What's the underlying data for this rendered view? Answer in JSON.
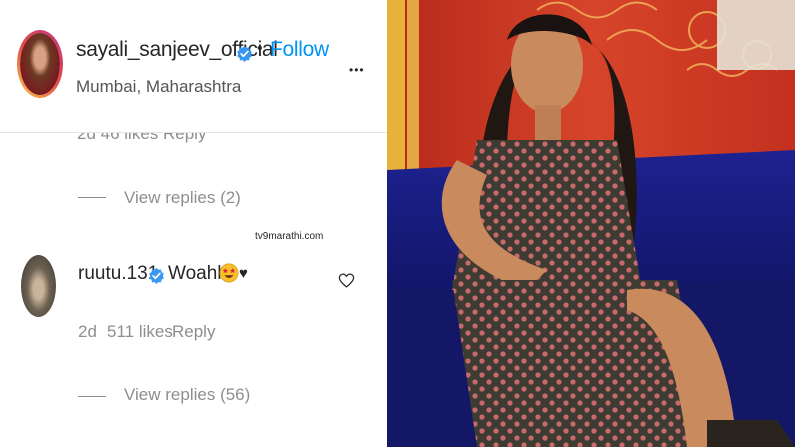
{
  "post_header": {
    "username": "sayali_sanjeev_official",
    "separator": "•",
    "follow_label": "Follow",
    "location": "Mumbai, Maharashtra",
    "more_label": "•••"
  },
  "previous_comment": {
    "meta": "2d   46 likes   Reply",
    "view_replies": "View replies (2)"
  },
  "watermark": "tv9marathi.com",
  "comment": {
    "username": "ruutu.131",
    "text": "Woahh",
    "emoji": "star-struck-emoji",
    "trailing": "♥",
    "time": "2d",
    "likes": "511 likes",
    "reply_label": "Reply",
    "view_replies": "View replies (56)"
  },
  "icons": {
    "verified": "verified-badge-icon",
    "like": "heart-outline-icon",
    "more": "more-options-icon"
  },
  "colors": {
    "follow": "#0095f6",
    "verified": "#3897f0",
    "muted_text": "#8e8e8e",
    "primary_text": "#262626"
  }
}
